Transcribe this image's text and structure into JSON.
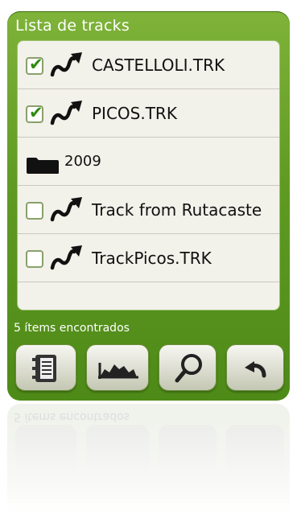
{
  "window": {
    "title": "Lista de tracks"
  },
  "items": [
    {
      "type": "track",
      "checked": true,
      "label": "CASTELLOLI.TRK"
    },
    {
      "type": "track",
      "checked": true,
      "label": "PICOS.TRK"
    },
    {
      "type": "folder",
      "checked": null,
      "label": "2009"
    },
    {
      "type": "track",
      "checked": false,
      "label": "Track from Rutacaste"
    },
    {
      "type": "track",
      "checked": false,
      "label": "TrackPicos.TRK"
    }
  ],
  "status": {
    "text": "5 ítems encontrados"
  },
  "toolbar": {
    "buttons": [
      {
        "icon": "notebook-icon"
      },
      {
        "icon": "elevation-profile-icon"
      },
      {
        "icon": "search-icon"
      },
      {
        "icon": "back-arrow-icon"
      }
    ]
  },
  "colors": {
    "panel": "#5f9a22",
    "list_background": "#f2f1ea",
    "check": "#2e8b10"
  }
}
